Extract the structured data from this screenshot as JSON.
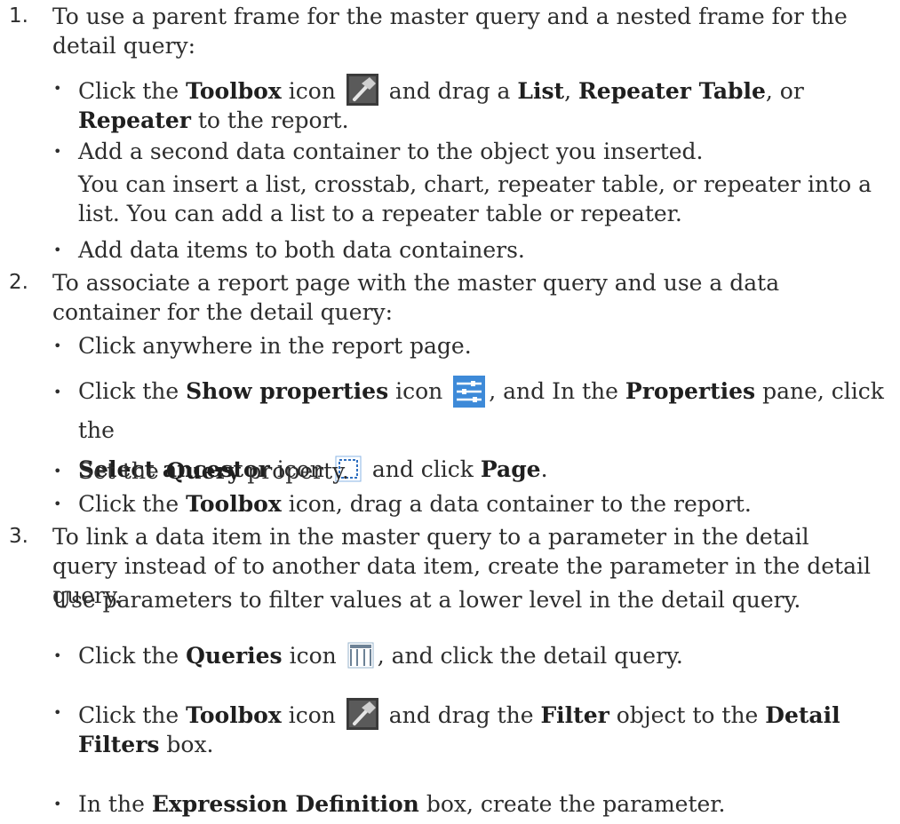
{
  "steps": [
    {
      "number": "1.",
      "intro": "To use a parent frame for the master query and a nested frame for the detail query:",
      "bullets": [
        {
          "t1": "Click the ",
          "b1": "Toolbox",
          "t2": " icon",
          "t3": " and drag a ",
          "b2": "List",
          "t4": ", ",
          "b3": "Repeater Table",
          "t5": ", or ",
          "b4": "Repeater",
          "t6": " to the report."
        },
        {
          "text": "Add a second data container to the object you inserted."
        },
        {
          "text": "Add data items to both data containers."
        }
      ],
      "note": "You can insert a list, crosstab, chart, repeater table, or repeater into a list. You can add a list to a repeater table or repeater."
    },
    {
      "number": "2.",
      "intro": "To associate a report page with the master query and use a data container for the detail query:",
      "bullets": [
        {
          "text": "Click anywhere in the report page."
        },
        {
          "t1": "Click the ",
          "b1": "Show properties",
          "t2": " icon",
          "t3": ", and In the ",
          "b2": "Properties",
          "t4": " pane, click the",
          "b3": "Select ancestor",
          "t5": " icon",
          "t6": " and click ",
          "b4": "Page",
          "t7": "."
        },
        {
          "t1": "Set the ",
          "b1": "Query",
          "t2": " property."
        },
        {
          "t1": "Click the ",
          "b1": "Toolbox",
          "t2": " icon, drag a data container to the report."
        }
      ]
    },
    {
      "number": "3.",
      "intro": "To link a data item in the master query to a parameter in the detail query instead of to another data item, create the parameter in the detail query.",
      "note": "Use parameters to filter values at a lower level in the detail query.",
      "bullets": [
        {
          "t1": "Click the ",
          "b1": "Queries",
          "t2": " icon",
          "t3": ", and click the detail query."
        },
        {
          "t1": "Click the ",
          "b1": "Toolbox",
          "t2": " icon",
          "t3": " and drag the ",
          "b2": "Filter",
          "t4": " object to the ",
          "b3": "Detail Filters",
          "t5": " box."
        },
        {
          "t1": "In the ",
          "b1": "Expression Definition",
          "t2": " box, create the parameter."
        }
      ]
    }
  ],
  "bullet_glyph": "•",
  "icons": {
    "toolbox": "hammer-icon",
    "properties": "sliders-icon",
    "ancestor": "dashed-square-icon",
    "queries": "columns-icon"
  }
}
